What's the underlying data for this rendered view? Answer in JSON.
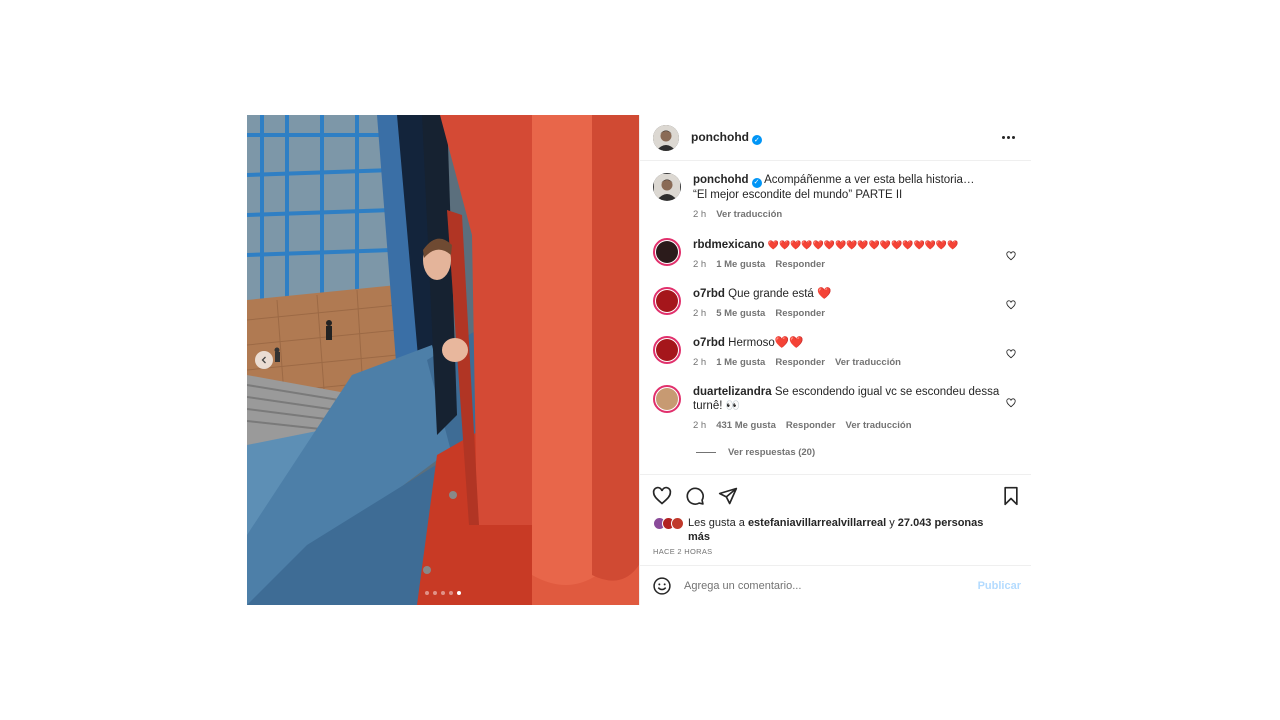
{
  "post": {
    "author": "ponchohd",
    "caption_line1": "Acompáñenme a ver esta bella historia…",
    "caption_line2": "“El mejor escondite del mundo” PARTE II",
    "caption_time": "2 h",
    "caption_translate": "Ver traducción",
    "carousel": {
      "total": 5,
      "active": 5
    }
  },
  "comments": [
    {
      "user": "rbdmexicano",
      "text": "❤️❤️❤️❤️❤️❤️❤️❤️❤️❤️❤️❤️❤️❤️❤️❤️❤️",
      "time": "2 h",
      "likes": "1 Me gusta",
      "reply": "Responder",
      "translate": ""
    },
    {
      "user": "o7rbd",
      "text": "Que grande está ❤️",
      "time": "2 h",
      "likes": "5 Me gusta",
      "reply": "Responder",
      "translate": ""
    },
    {
      "user": "o7rbd",
      "text": "Hermoso❤️❤️",
      "time": "2 h",
      "likes": "1 Me gusta",
      "reply": "Responder",
      "translate": "Ver traducción"
    },
    {
      "user": "duartelizandra",
      "text": "Se escondendo igual vc se escondeu dessa turnê! 👀",
      "time": "2 h",
      "likes": "431 Me gusta",
      "reply": "Responder",
      "translate": "Ver traducción"
    }
  ],
  "replies_label": "Ver respuestas (20)",
  "likes": {
    "prefix": "Les gusta a",
    "user": "estefaniavillarrealvillarreal",
    "conjunction": "y",
    "count": "27.043 personas",
    "suffix": "más"
  },
  "timestamp": "HACE 2 HORAS",
  "add_comment": {
    "placeholder": "Agrega un comentario...",
    "publish": "Publicar"
  },
  "colors": {
    "verified": "#0095f6",
    "publish": "#b3dbff",
    "ring": "#e1306c"
  }
}
